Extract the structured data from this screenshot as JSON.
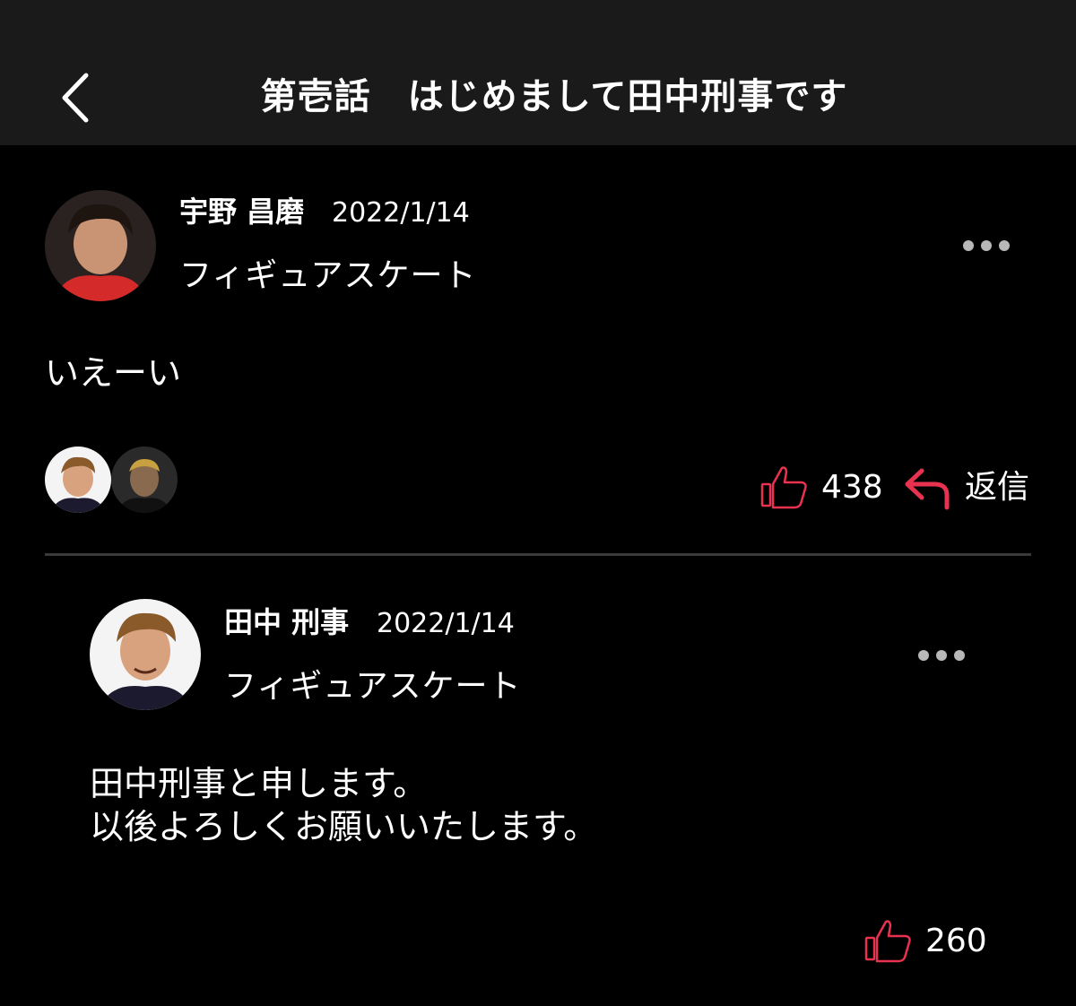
{
  "header": {
    "title": "第壱話　はじめまして田中刑事です"
  },
  "post": {
    "username": "宇野 昌磨",
    "date": "2022/1/14",
    "category": "フィギュアスケート",
    "body": "いえーい",
    "likes": "438",
    "reply_label": "返信"
  },
  "reply": {
    "username": "田中 刑事",
    "date": "2022/1/14",
    "category": "フィギュアスケート",
    "body_line1": "田中刑事と申します。",
    "body_line2": "以後よろしくお願いいたします。",
    "likes": "260"
  },
  "colors": {
    "background": "#000000",
    "header": "#1a1a1a",
    "accent": "#e8324f",
    "divider": "#3a3a3a",
    "dots": "#b8b8b8"
  }
}
